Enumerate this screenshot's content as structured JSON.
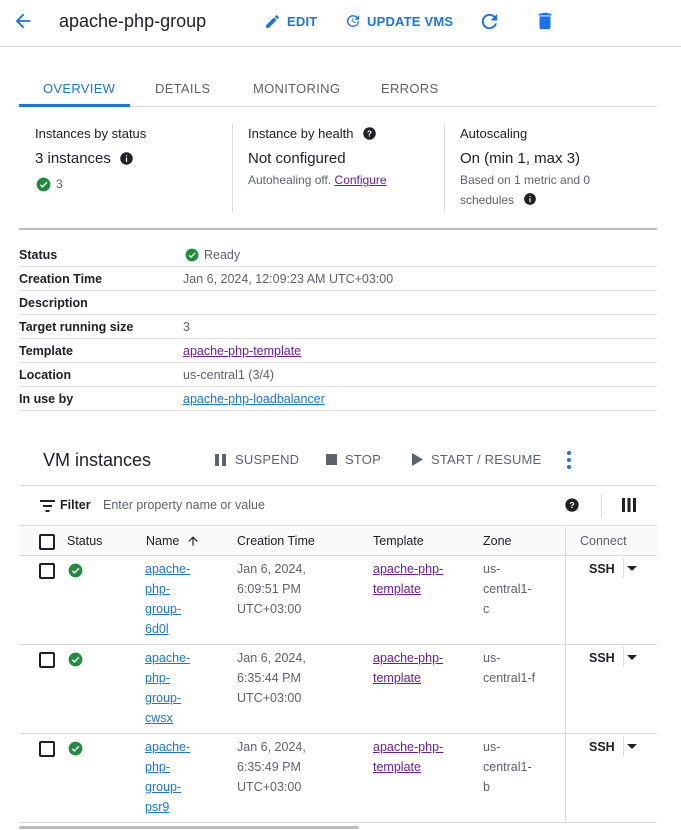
{
  "header": {
    "title": "apache-php-group",
    "edit_label": "EDIT",
    "update_label": "UPDATE VMS"
  },
  "tabs": [
    {
      "label": "OVERVIEW",
      "active": true
    },
    {
      "label": "DETAILS",
      "active": false
    },
    {
      "label": "MONITORING",
      "active": false
    },
    {
      "label": "ERRORS",
      "active": false
    }
  ],
  "summary": {
    "instances_by_status": {
      "heading": "Instances by status",
      "value": "3 instances",
      "ok_count": "3"
    },
    "instance_by_health": {
      "heading": "Instance by health",
      "value": "Not configured",
      "note": "Autohealing off.",
      "link": "Configure"
    },
    "autoscaling": {
      "heading": "Autoscaling",
      "value": "On (min 1, max 3)",
      "note_line1": "Based on 1 metric and 0",
      "note_line2": "schedules"
    }
  },
  "details": {
    "status_label": "Status",
    "status_value": "Ready",
    "creation_label": "Creation Time",
    "creation_value": "Jan 6, 2024, 12:09:23 AM UTC+03:00",
    "description_label": "Description",
    "description_value": "",
    "target_label": "Target running size",
    "target_value": "3",
    "template_label": "Template",
    "template_value": "apache-php-template",
    "location_label": "Location",
    "location_value": "us-central1 (3/4)",
    "inuse_label": "In use by",
    "inuse_value": "apache-php-loadbalancer"
  },
  "vm_instances": {
    "title": "VM instances",
    "actions": {
      "suspend": "SUSPEND",
      "stop": "STOP",
      "start": "START / RESUME"
    },
    "filter": {
      "label": "Filter",
      "placeholder": "Enter property name or value"
    },
    "columns": {
      "status": "Status",
      "name": "Name",
      "creation": "Creation Time",
      "template": "Template",
      "zone": "Zone",
      "connect": "Connect"
    },
    "rows": [
      {
        "name": [
          "apache-",
          "php-",
          "group-",
          "6d0l"
        ],
        "creation": [
          "Jan 6, 2024,",
          "6:09:51 PM",
          "UTC+03:00"
        ],
        "template": [
          "apache-php-",
          "template"
        ],
        "zone": [
          "us-",
          "central1-",
          "c"
        ],
        "connect": "SSH"
      },
      {
        "name": [
          "apache-",
          "php-",
          "group-",
          "cwsx"
        ],
        "creation": [
          "Jan 6, 2024,",
          "6:35:44 PM",
          "UTC+03:00"
        ],
        "template": [
          "apache-php-",
          "template"
        ],
        "zone": [
          "us-",
          "central1-f"
        ],
        "connect": "SSH"
      },
      {
        "name": [
          "apache-",
          "php-",
          "group-",
          "psr9"
        ],
        "creation": [
          "Jan 6, 2024,",
          "6:35:49 PM",
          "UTC+03:00"
        ],
        "template": [
          "apache-php-",
          "template"
        ],
        "zone": [
          "us-",
          "central1-",
          "b"
        ],
        "connect": "SSH"
      }
    ]
  },
  "colors": {
    "accent": "#1a73e8",
    "success": "#1e8e3e",
    "visited_link": "#681da8"
  }
}
